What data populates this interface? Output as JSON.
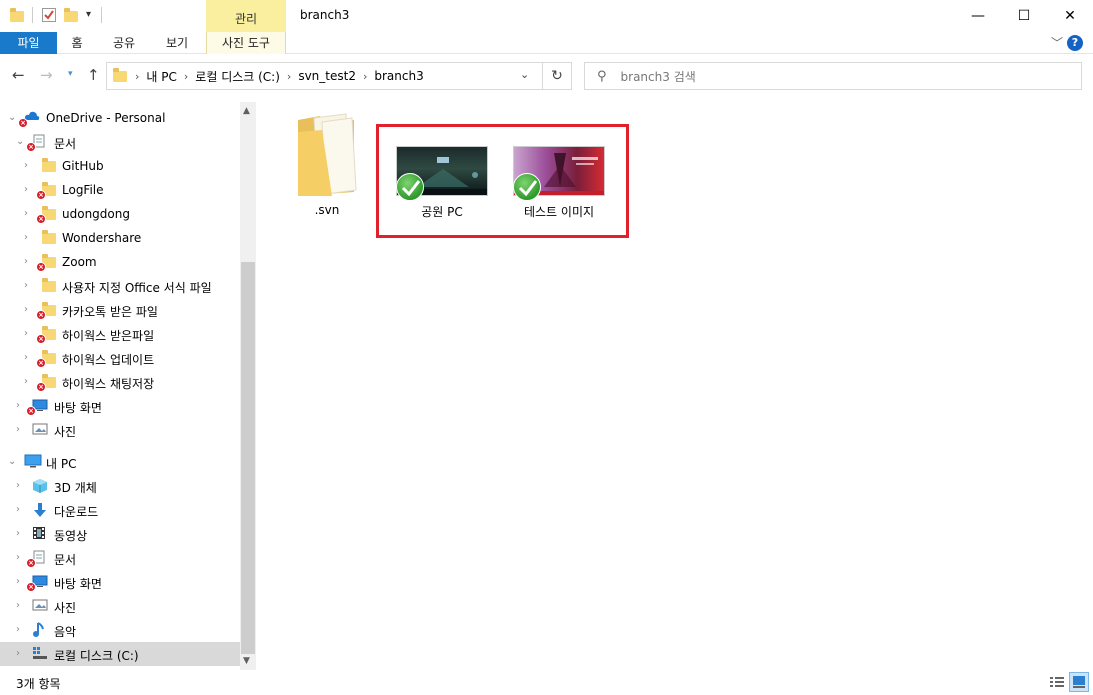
{
  "window": {
    "title": "branch3",
    "context_tab_group": "관리",
    "controls": {
      "minimize": "—",
      "maximize": "☐",
      "close": "✕"
    }
  },
  "ribbon": {
    "tabs": [
      "파일",
      "홈",
      "공유",
      "보기",
      "사진 도구"
    ],
    "help": "?"
  },
  "address": {
    "breadcrumb": [
      "내 PC",
      "로컬 디스크 (C:)",
      "svn_test2",
      "branch3"
    ],
    "search_placeholder": "branch3 검색"
  },
  "nav_pane": {
    "items": [
      {
        "label": "OneDrive - Personal",
        "icon": "onedrive-icon",
        "error": true,
        "expanded": true
      },
      {
        "label": "문서",
        "icon": "documents-icon",
        "error": true,
        "expanded": true
      },
      {
        "label": "GitHub",
        "icon": "folder-icon",
        "error": false
      },
      {
        "label": "LogFile",
        "icon": "folder-icon",
        "error": true
      },
      {
        "label": "udongdong",
        "icon": "folder-icon",
        "error": true
      },
      {
        "label": "Wondershare",
        "icon": "folder-icon",
        "error": false
      },
      {
        "label": "Zoom",
        "icon": "folder-icon",
        "error": true
      },
      {
        "label": "사용자 지정 Office 서식 파일",
        "icon": "folder-icon",
        "error": false
      },
      {
        "label": "카카오톡 받은 파일",
        "icon": "folder-icon",
        "error": true
      },
      {
        "label": "하이웍스 받은파일",
        "icon": "folder-icon",
        "error": true
      },
      {
        "label": "하이웍스 업데이트",
        "icon": "folder-icon",
        "error": true
      },
      {
        "label": "하이웍스 채팅저장",
        "icon": "folder-icon",
        "error": true
      },
      {
        "label": "바탕 화면",
        "icon": "desktop-icon",
        "error": true
      },
      {
        "label": "사진",
        "icon": "pictures-icon",
        "error": false
      },
      {
        "label": "내 PC",
        "icon": "pc-icon",
        "error": false,
        "expanded": true
      },
      {
        "label": "3D 개체",
        "icon": "3d-objects-icon",
        "error": false
      },
      {
        "label": "다운로드",
        "icon": "download-icon",
        "error": false
      },
      {
        "label": "동영상",
        "icon": "video-icon",
        "error": false
      },
      {
        "label": "문서",
        "icon": "documents-icon",
        "error": true
      },
      {
        "label": "바탕 화면",
        "icon": "desktop-icon",
        "error": true
      },
      {
        "label": "사진",
        "icon": "pictures-icon",
        "error": false
      },
      {
        "label": "음악",
        "icon": "music-icon",
        "error": false
      },
      {
        "label": "로컬 디스크 (C:)",
        "icon": "drive-icon",
        "error": false,
        "selected": true
      }
    ]
  },
  "files": [
    {
      "name": ".svn",
      "type": "folder"
    },
    {
      "name": "공원 PC",
      "type": "image",
      "status": "checkmark"
    },
    {
      "name": "테스트 이미지",
      "type": "image",
      "status": "checkmark"
    }
  ],
  "status": {
    "count": "3개 항목"
  },
  "colors": {
    "accent": "#1979ca",
    "highlight_box": "#e0202a",
    "context_tab": "#f9ef9f"
  }
}
